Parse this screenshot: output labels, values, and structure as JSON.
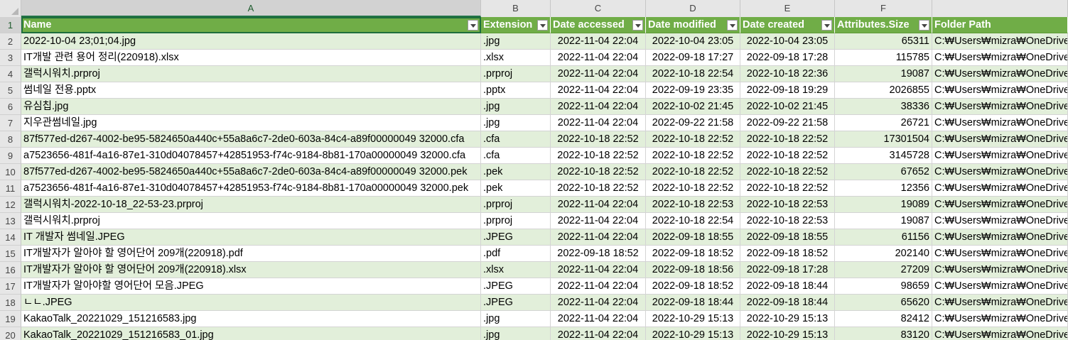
{
  "columns": [
    "A",
    "B",
    "C",
    "D",
    "E",
    "F",
    ""
  ],
  "headers": [
    "Name",
    "Extension",
    "Date accessed",
    "Date modified",
    "Date created",
    "Attributes.Size",
    "Folder Path"
  ],
  "rows": [
    {
      "n": "2",
      "name": "2022-10-04 23;01;04.jpg",
      "ext": ".jpg",
      "acc": "2022-11-04 22:04",
      "mod": "2022-10-04 23:05",
      "cre": "2022-10-04 23:05",
      "size": "65311",
      "path": "C:₩Users₩mizra₩OneDrive"
    },
    {
      "n": "3",
      "name": "IT개발 관련 용어 정리(220918).xlsx",
      "ext": ".xlsx",
      "acc": "2022-11-04 22:04",
      "mod": "2022-09-18 17:27",
      "cre": "2022-09-18 17:28",
      "size": "115785",
      "path": "C:₩Users₩mizra₩OneDrive"
    },
    {
      "n": "4",
      "name": "갤럭시워치.prproj",
      "ext": ".prproj",
      "acc": "2022-11-04 22:04",
      "mod": "2022-10-18 22:54",
      "cre": "2022-10-18 22:36",
      "size": "19087",
      "path": "C:₩Users₩mizra₩OneDrive"
    },
    {
      "n": "5",
      "name": "썸네일 전용.pptx",
      "ext": ".pptx",
      "acc": "2022-11-04 22:04",
      "mod": "2022-09-19 23:35",
      "cre": "2022-09-18 19:29",
      "size": "2026855",
      "path": "C:₩Users₩mizra₩OneDrive"
    },
    {
      "n": "6",
      "name": "유심칩.jpg",
      "ext": ".jpg",
      "acc": "2022-11-04 22:04",
      "mod": "2022-10-02 21:45",
      "cre": "2022-10-02 21:45",
      "size": "38336",
      "path": "C:₩Users₩mizra₩OneDrive"
    },
    {
      "n": "7",
      "name": "지우관썸네일.jpg",
      "ext": ".jpg",
      "acc": "2022-11-04 22:04",
      "mod": "2022-09-22 21:58",
      "cre": "2022-09-22 21:58",
      "size": "26721",
      "path": "C:₩Users₩mizra₩OneDrive"
    },
    {
      "n": "8",
      "name": "87f577ed-d267-4002-be95-5824650a440c+55a8a6c7-2de0-603a-84c4-a89f00000049 32000.cfa",
      "ext": ".cfa",
      "acc": "2022-10-18 22:52",
      "mod": "2022-10-18 22:52",
      "cre": "2022-10-18 22:52",
      "size": "17301504",
      "path": "C:₩Users₩mizra₩OneDrive"
    },
    {
      "n": "9",
      "name": "a7523656-481f-4a16-87e1-310d04078457+42851953-f74c-9184-8b81-170a00000049 32000.cfa",
      "ext": ".cfa",
      "acc": "2022-10-18 22:52",
      "mod": "2022-10-18 22:52",
      "cre": "2022-10-18 22:52",
      "size": "3145728",
      "path": "C:₩Users₩mizra₩OneDrive"
    },
    {
      "n": "10",
      "name": "87f577ed-d267-4002-be95-5824650a440c+55a8a6c7-2de0-603a-84c4-a89f00000049 32000.pek",
      "ext": ".pek",
      "acc": "2022-10-18 22:52",
      "mod": "2022-10-18 22:52",
      "cre": "2022-10-18 22:52",
      "size": "67652",
      "path": "C:₩Users₩mizra₩OneDrive"
    },
    {
      "n": "11",
      "name": "a7523656-481f-4a16-87e1-310d04078457+42851953-f74c-9184-8b81-170a00000049 32000.pek",
      "ext": ".pek",
      "acc": "2022-10-18 22:52",
      "mod": "2022-10-18 22:52",
      "cre": "2022-10-18 22:52",
      "size": "12356",
      "path": "C:₩Users₩mizra₩OneDrive"
    },
    {
      "n": "12",
      "name": "갤럭시워치-2022-10-18_22-53-23.prproj",
      "ext": ".prproj",
      "acc": "2022-11-04 22:04",
      "mod": "2022-10-18 22:53",
      "cre": "2022-10-18 22:53",
      "size": "19089",
      "path": "C:₩Users₩mizra₩OneDrive"
    },
    {
      "n": "13",
      "name": "갤럭시워치.prproj",
      "ext": ".prproj",
      "acc": "2022-11-04 22:04",
      "mod": "2022-10-18 22:54",
      "cre": "2022-10-18 22:53",
      "size": "19087",
      "path": "C:₩Users₩mizra₩OneDrive"
    },
    {
      "n": "14",
      "name": "IT 개발자 썸네일.JPEG",
      "ext": ".JPEG",
      "acc": "2022-11-04 22:04",
      "mod": "2022-09-18 18:55",
      "cre": "2022-09-18 18:55",
      "size": "61156",
      "path": "C:₩Users₩mizra₩OneDrive"
    },
    {
      "n": "15",
      "name": "IT개발자가 알아야 할 영어단어 209개(220918).pdf",
      "ext": ".pdf",
      "acc": "2022-09-18 18:52",
      "mod": "2022-09-18 18:52",
      "cre": "2022-09-18 18:52",
      "size": "202140",
      "path": "C:₩Users₩mizra₩OneDrive"
    },
    {
      "n": "16",
      "name": "IT개발자가 알아야 할 영어단어 209개(220918).xlsx",
      "ext": ".xlsx",
      "acc": "2022-11-04 22:04",
      "mod": "2022-09-18 18:56",
      "cre": "2022-09-18 17:28",
      "size": "27209",
      "path": "C:₩Users₩mizra₩OneDrive"
    },
    {
      "n": "17",
      "name": "IT개발자가 알아야할 영어단어 모음.JPEG",
      "ext": ".JPEG",
      "acc": "2022-11-04 22:04",
      "mod": "2022-09-18 18:52",
      "cre": "2022-09-18 18:44",
      "size": "98659",
      "path": "C:₩Users₩mizra₩OneDrive"
    },
    {
      "n": "18",
      "name": "ㄴㄴ.JPEG",
      "ext": ".JPEG",
      "acc": "2022-11-04 22:04",
      "mod": "2022-09-18 18:44",
      "cre": "2022-09-18 18:44",
      "size": "65620",
      "path": "C:₩Users₩mizra₩OneDrive"
    },
    {
      "n": "19",
      "name": "KakaoTalk_20221029_151216583.jpg",
      "ext": ".jpg",
      "acc": "2022-11-04 22:04",
      "mod": "2022-10-29 15:13",
      "cre": "2022-10-29 15:13",
      "size": "82412",
      "path": "C:₩Users₩mizra₩OneDrive"
    },
    {
      "n": "20",
      "name": "KakaoTalk_20221029_151216583_01.jpg",
      "ext": ".jpg",
      "acc": "2022-11-04 22:04",
      "mod": "2022-10-29 15:13",
      "cre": "2022-10-29 15:13",
      "size": "83120",
      "path": "C:₩Users₩mizra₩OneDrive"
    }
  ]
}
